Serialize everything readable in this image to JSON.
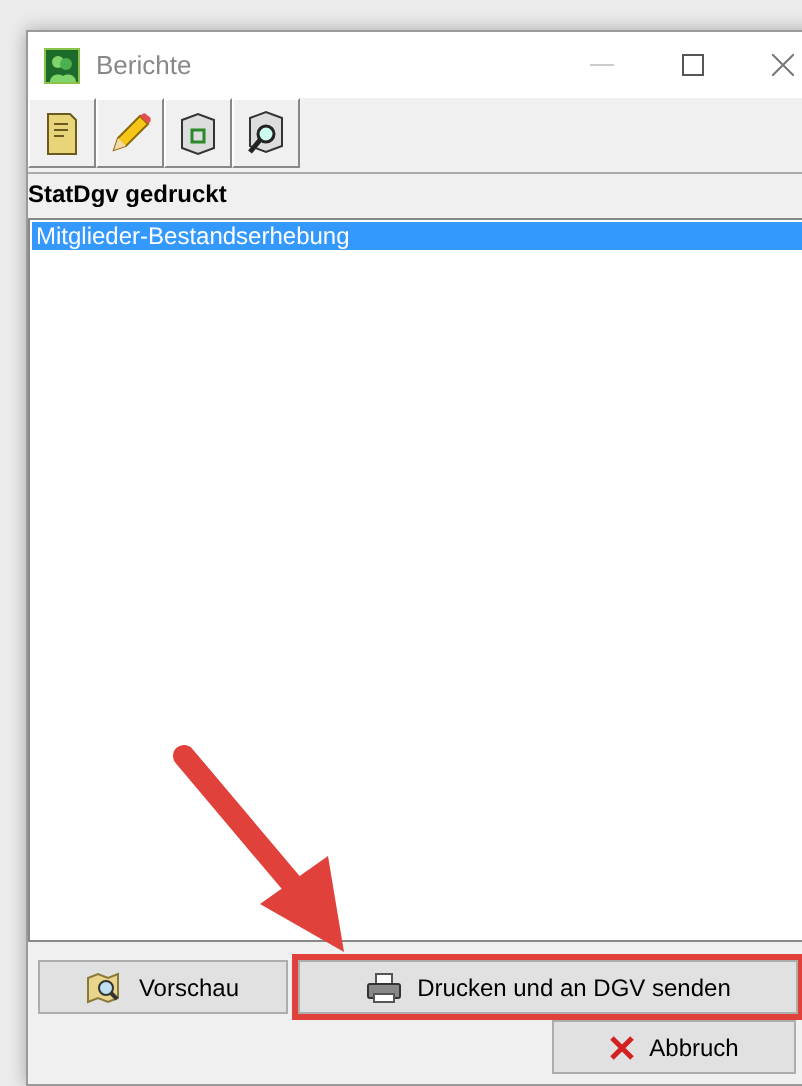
{
  "window": {
    "title": "Berichte"
  },
  "toolbar": [
    {
      "kind": "document"
    },
    {
      "kind": "pencil"
    },
    {
      "kind": "box"
    },
    {
      "kind": "box-search"
    }
  ],
  "heading": "StatDgv gedruckt",
  "list": [
    {
      "label": "Mitglieder-Bestandserhebung",
      "selected": true
    }
  ],
  "buttons": [
    {
      "kind": "preview",
      "label": "Vorschau",
      "highlighted": false
    },
    {
      "kind": "print",
      "label": "Drucken und an DGV senden",
      "highlighted": true
    },
    {
      "kind": "cancel",
      "label": "Abbruch",
      "highlighted": false
    }
  ]
}
